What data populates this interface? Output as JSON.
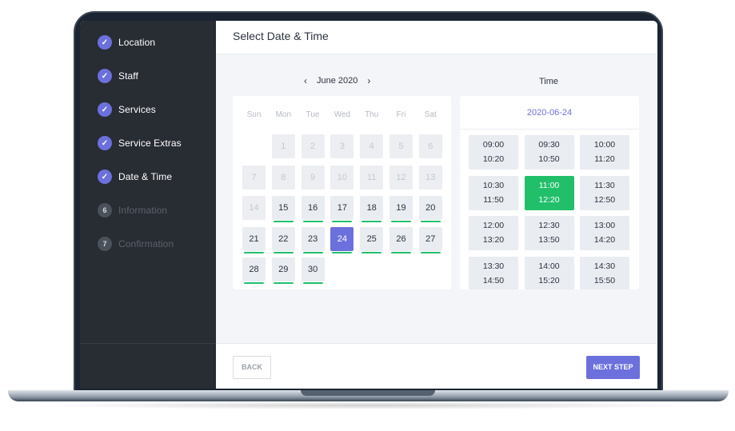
{
  "sidebar": {
    "steps": [
      {
        "label": "Location",
        "state": "done",
        "marker": "✓"
      },
      {
        "label": "Staff",
        "state": "done",
        "marker": "✓"
      },
      {
        "label": "Services",
        "state": "done",
        "marker": "✓"
      },
      {
        "label": "Service Extras",
        "state": "done",
        "marker": "✓"
      },
      {
        "label": "Date & Time",
        "state": "done",
        "marker": "✓"
      },
      {
        "label": "Information",
        "state": "pending",
        "marker": "6"
      },
      {
        "label": "Confirmation",
        "state": "pending",
        "marker": "7"
      }
    ]
  },
  "header": {
    "title": "Select Date & Time"
  },
  "calendar": {
    "month_label": "June 2020",
    "prev_icon": "chevron-left-icon",
    "next_icon": "chevron-right-icon",
    "weekdays": [
      "Sun",
      "Mon",
      "Tue",
      "Wed",
      "Thu",
      "Fri",
      "Sat"
    ],
    "leading_blanks": 1,
    "days": [
      {
        "day": "1",
        "state": "disabled"
      },
      {
        "day": "2",
        "state": "disabled"
      },
      {
        "day": "3",
        "state": "disabled"
      },
      {
        "day": "4",
        "state": "disabled"
      },
      {
        "day": "5",
        "state": "disabled"
      },
      {
        "day": "6",
        "state": "disabled"
      },
      {
        "day": "7",
        "state": "disabled"
      },
      {
        "day": "8",
        "state": "disabled"
      },
      {
        "day": "9",
        "state": "disabled"
      },
      {
        "day": "10",
        "state": "disabled"
      },
      {
        "day": "11",
        "state": "disabled"
      },
      {
        "day": "12",
        "state": "disabled"
      },
      {
        "day": "13",
        "state": "disabled"
      },
      {
        "day": "14",
        "state": "disabled"
      },
      {
        "day": "15",
        "state": "available"
      },
      {
        "day": "16",
        "state": "available"
      },
      {
        "day": "17",
        "state": "available"
      },
      {
        "day": "18",
        "state": "available"
      },
      {
        "day": "19",
        "state": "available"
      },
      {
        "day": "20",
        "state": "available"
      },
      {
        "day": "21",
        "state": "available"
      },
      {
        "day": "22",
        "state": "available"
      },
      {
        "day": "23",
        "state": "available"
      },
      {
        "day": "24",
        "state": "selected"
      },
      {
        "day": "25",
        "state": "available"
      },
      {
        "day": "26",
        "state": "available"
      },
      {
        "day": "27",
        "state": "available"
      },
      {
        "day": "28",
        "state": "available"
      },
      {
        "day": "29",
        "state": "available"
      },
      {
        "day": "30",
        "state": "available"
      }
    ]
  },
  "time": {
    "heading": "Time",
    "selected_date": "2020-06-24",
    "slots": [
      {
        "start": "09:00",
        "end": "10:20",
        "selected": false
      },
      {
        "start": "09:30",
        "end": "10:50",
        "selected": false
      },
      {
        "start": "10:00",
        "end": "11:20",
        "selected": false
      },
      {
        "start": "10:30",
        "end": "11:50",
        "selected": false
      },
      {
        "start": "11:00",
        "end": "12:20",
        "selected": true
      },
      {
        "start": "11:30",
        "end": "12:50",
        "selected": false
      },
      {
        "start": "12:00",
        "end": "13:20",
        "selected": false
      },
      {
        "start": "12:30",
        "end": "13:50",
        "selected": false
      },
      {
        "start": "13:00",
        "end": "14:20",
        "selected": false
      },
      {
        "start": "13:30",
        "end": "14:50",
        "selected": false
      },
      {
        "start": "14:00",
        "end": "15:20",
        "selected": false
      },
      {
        "start": "14:30",
        "end": "15:50",
        "selected": false
      }
    ]
  },
  "footer": {
    "back_label": "BACK",
    "next_label": "NEXT STEP"
  },
  "colors": {
    "accent": "#6c70dc",
    "success": "#22bf6b",
    "sidebar_bg": "#282c33"
  }
}
